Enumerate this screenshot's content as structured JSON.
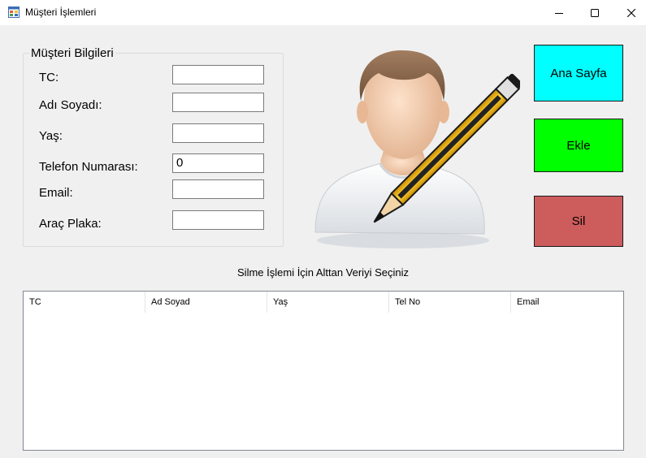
{
  "window": {
    "title": "Müşteri İşlemleri"
  },
  "customer_group": {
    "legend": "Müşteri Bilgileri",
    "fields": [
      {
        "label": "TC:",
        "value": ""
      },
      {
        "label": "Adı Soyadı:",
        "value": ""
      },
      {
        "label": "Yaş:",
        "value": ""
      },
      {
        "label": "Telefon Numarası:",
        "value": "0"
      },
      {
        "label": "Email:",
        "value": ""
      },
      {
        "label": "Araç Plaka:",
        "value": ""
      }
    ]
  },
  "buttons": {
    "home": {
      "label": "Ana Sayfa",
      "color": "#00ffff"
    },
    "add": {
      "label": "Ekle",
      "color": "#00ff00"
    },
    "delete": {
      "label": "Sil",
      "color": "#cd5c5c"
    }
  },
  "info_text": "Silme İşlemi İçin Alttan Veriyi Seçiniz",
  "table": {
    "columns": [
      "TC",
      "Ad Soyad",
      "Yaş",
      "Tel No",
      "Email"
    ],
    "rows": []
  }
}
